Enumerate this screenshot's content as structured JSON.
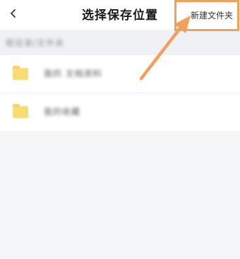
{
  "header": {
    "title": "选择保存位置",
    "new_folder_label": "新建文件夹",
    "back_icon": "chevron-left-icon"
  },
  "path_bar": {
    "text": "根目录/文件夹"
  },
  "folders": [
    {
      "name": "我的 文档资料",
      "icon": "folder-icon"
    },
    {
      "name": "我的收藏",
      "icon": "folder-icon"
    }
  ],
  "annotation": {
    "color": "#f5a05a"
  }
}
